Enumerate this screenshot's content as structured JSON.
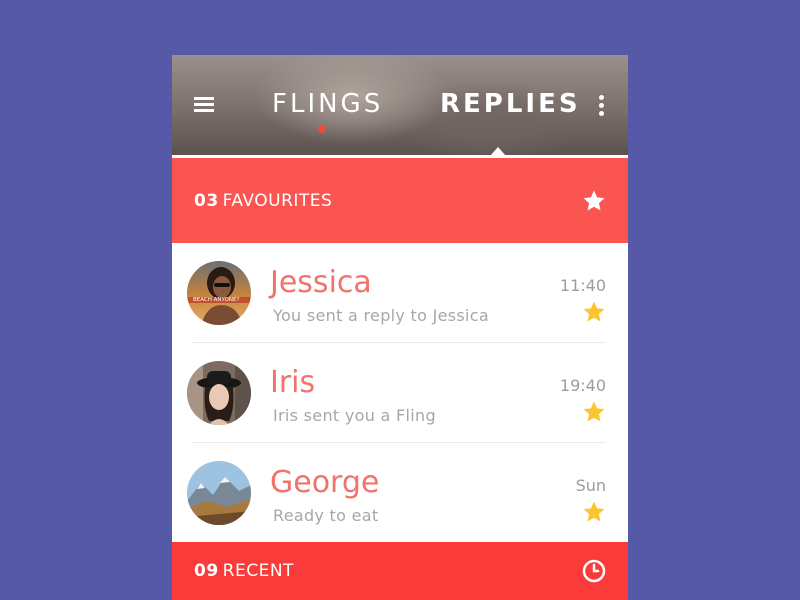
{
  "header": {
    "tabs": [
      {
        "label": "FLINGS"
      },
      {
        "label": "REPLIES"
      }
    ]
  },
  "favourites": {
    "count": "03",
    "label": "FAVOURITES"
  },
  "conversations": [
    {
      "name": "Jessica",
      "preview": "You sent a reply to Jessica",
      "time": "11:40",
      "avatar_caption": "BEACH ANYONE?"
    },
    {
      "name": "Iris",
      "preview": "Iris sent you a Fling",
      "time": "19:40"
    },
    {
      "name": "George",
      "preview": "Ready to eat",
      "time": "Sun"
    }
  ],
  "recent": {
    "count": "09",
    "label": "RECENT"
  },
  "colors": {
    "background": "#5659a8",
    "accent": "#fb5552",
    "name": "#f1736b",
    "star": "#fbc531"
  },
  "icons": {
    "menu": "hamburger-menu-icon",
    "more": "more-vertical-icon",
    "favourites": "star-icon",
    "recent": "clock-icon",
    "row_star": "star-icon"
  }
}
